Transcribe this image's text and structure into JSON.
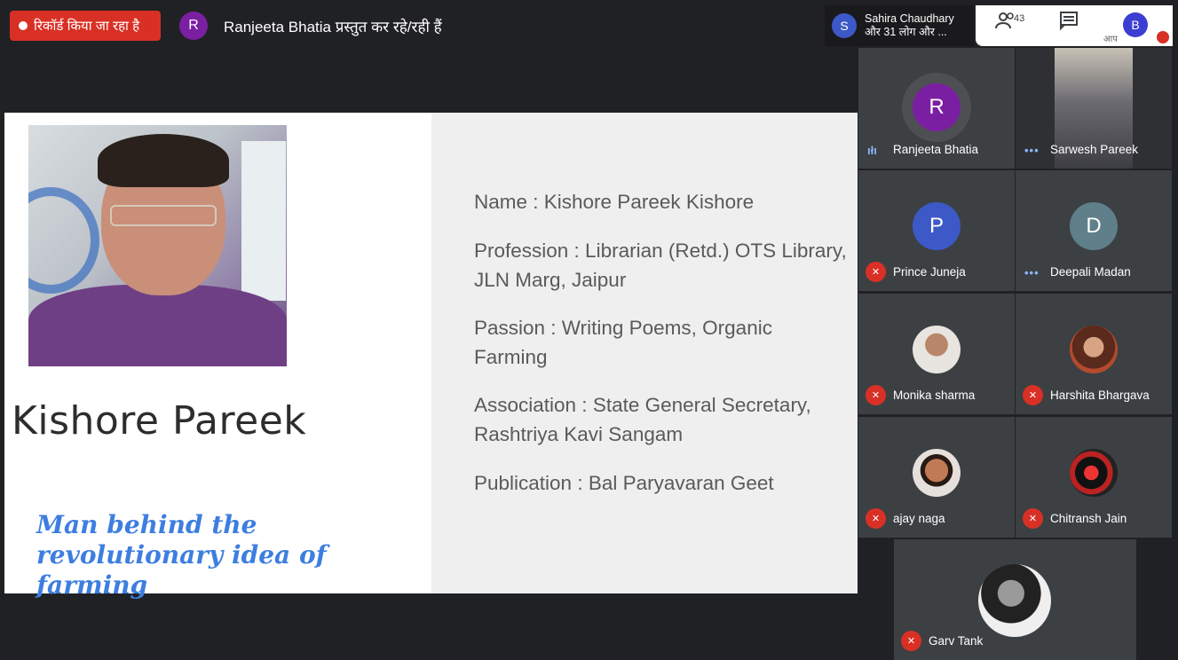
{
  "recording": {
    "label": "रिकॉर्ड किया जा रहा है"
  },
  "presenter": {
    "initial": "R",
    "text": "Ranjeeta Bhatia प्रस्तुत कर रहे/रही हैं"
  },
  "viewer_chip": {
    "initial": "S",
    "line1": "Sahira Chaudhary",
    "line2": "और 31 लोग और ..."
  },
  "controls": {
    "participant_count": "43",
    "self_initial": "B",
    "self_label": "आप"
  },
  "slide": {
    "person_name": "Kishore Pareek",
    "tagline": "Man behind the revolutionary idea of farming",
    "info": [
      "Name : Kishore Pareek Kishore",
      "Profession : Librarian (Retd.) OTS Library, JLN Marg, Jaipur",
      "Passion : Writing Poems, Organic Farming",
      "Association : State General Secretary, Rashtriya Kavi Sangam",
      "Publication : Bal Paryavaran Geet"
    ]
  },
  "participants": [
    {
      "name": "Ranjeeta Bhatia",
      "initial": "R",
      "color": "#7b1fa2",
      "status": "speaking"
    },
    {
      "name": "Sarwesh Pareek",
      "initial": "",
      "color": "#5f6368",
      "status": "dots"
    },
    {
      "name": "Prince Juneja",
      "initial": "P",
      "color": "#3c59c7",
      "status": "muted"
    },
    {
      "name": "Deepali Madan",
      "initial": "D",
      "color": "#5f7f8a",
      "status": "dots"
    },
    {
      "name": "Monika sharma",
      "initial": "",
      "color": "#b5a89a",
      "status": "muted"
    },
    {
      "name": "Harshita Bhargava",
      "initial": "",
      "color": "#a05a3c",
      "status": "muted"
    },
    {
      "name": "ajay naga",
      "initial": "",
      "color": "#8a5a44",
      "status": "muted"
    },
    {
      "name": "Chitransh Jain",
      "initial": "",
      "color": "#a02020",
      "status": "muted"
    },
    {
      "name": "Garv Tank",
      "initial": "",
      "color": "#444",
      "status": "muted"
    }
  ]
}
